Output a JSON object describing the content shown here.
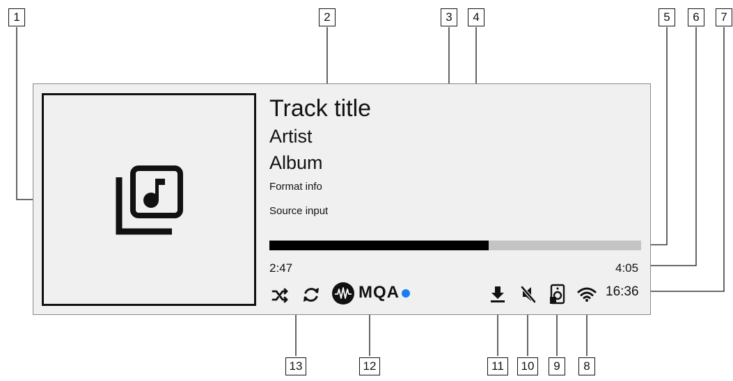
{
  "track": {
    "title": "Track title",
    "artist": "Artist",
    "album": "Album",
    "format_info": "Format info",
    "source_input": "Source input"
  },
  "playback": {
    "elapsed": "2:47",
    "duration": "4:05",
    "progress_fraction": 0.59
  },
  "status": {
    "clock": "16:36",
    "mqa_label": "MQA",
    "mqa_dot_color": "#1a7cf5"
  },
  "callouts": [
    "1",
    "2",
    "3",
    "4",
    "5",
    "6",
    "7",
    "8",
    "9",
    "10",
    "11",
    "12",
    "13"
  ],
  "icons": {
    "album_art": "music-note-album-icon",
    "shuffle": "shuffle-icon",
    "repeat": "repeat-icon",
    "mqa": "mqa-logo-icon",
    "download": "download-icon",
    "mute": "mute-icon",
    "speaker": "speaker-icon",
    "wifi": "wifi-icon"
  }
}
